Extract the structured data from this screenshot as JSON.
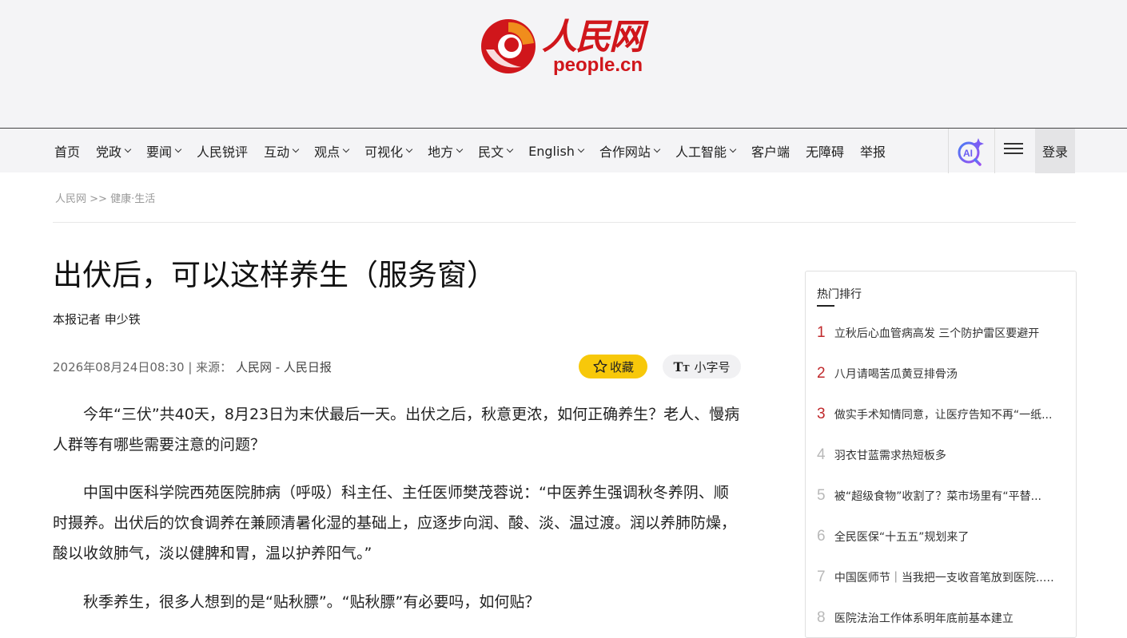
{
  "header": {
    "logo_cn": "人民网",
    "logo_en": "people.cn",
    "colors": {
      "brand": "#d0161b",
      "accent": "#f7c80a"
    }
  },
  "nav": {
    "items": [
      {
        "label": "首页",
        "dropdown": false
      },
      {
        "label": "党政",
        "dropdown": true
      },
      {
        "label": "要闻",
        "dropdown": true
      },
      {
        "label": "人民锐评",
        "dropdown": false
      },
      {
        "label": "互动",
        "dropdown": true
      },
      {
        "label": "观点",
        "dropdown": true
      },
      {
        "label": "可视化",
        "dropdown": true
      },
      {
        "label": "地方",
        "dropdown": true
      },
      {
        "label": "民文",
        "dropdown": true
      },
      {
        "label": "English",
        "dropdown": true
      },
      {
        "label": "合作网站",
        "dropdown": true
      },
      {
        "label": "人工智能",
        "dropdown": true
      },
      {
        "label": "客户端",
        "dropdown": false
      },
      {
        "label": "无障碍",
        "dropdown": false
      },
      {
        "label": "举报",
        "dropdown": false
      }
    ],
    "ai_icon": "ai-search-icon",
    "menu_icon": "hamburger-menu-icon",
    "login": "登录"
  },
  "breadcrumb": {
    "home": "人民网",
    "sep": ">>",
    "section": "健康·生活"
  },
  "article": {
    "title": "出伏后，可以这样养生（服务窗）",
    "byline": "本报记者 申少铁",
    "datetime": "2026年08月24日08:30",
    "source_label": "| 来源：",
    "source": "人民网 - 人民日报",
    "favorite": "收藏",
    "font_size": "小字号",
    "paragraphs": [
      "今年“三伏”共40天，8月23日为末伏最后一天。出伏之后，秋意更浓，如何正确养生？老人、慢病人群等有哪些需要注意的问题？",
      "中国中医科学院西苑医院肺病（呼吸）科主任、主任医师樊茂蓉说：“中医养生强调秋冬养阴、顺时摄养。出伏后的饮食调养在兼顾清暑化湿的基础上，应逐步向润、酸、淡、温过渡。润以养肺防燥，酸以收敛肺气，淡以健脾和胃，温以护养阳气。”",
      "秋季养生，很多人想到的是“贴秋膘”。“贴秋膘”有必要吗，如何贴？"
    ]
  },
  "sidebar": {
    "title": "热门排行",
    "items": [
      {
        "rank": "1",
        "text": "立秋后心血管病高发 三个防护雷区要避开"
      },
      {
        "rank": "2",
        "text": "八月请喝苦瓜黄豆排骨汤"
      },
      {
        "rank": "3",
        "text": "做实手术知情同意，让医疗告知不再“一纸..."
      },
      {
        "rank": "4",
        "text": "羽衣甘蓝需求热短板多"
      },
      {
        "rank": "5",
        "text": "被“超级食物”收割了？菜市场里有“平替..."
      },
      {
        "rank": "6",
        "text": "全民医保“十五五”规划来了"
      },
      {
        "rank": "7",
        "text": "中国医师节｜当我把一支收音笔放到医院......"
      },
      {
        "rank": "8",
        "text": "医院法治工作体系明年底前基本建立"
      }
    ]
  }
}
